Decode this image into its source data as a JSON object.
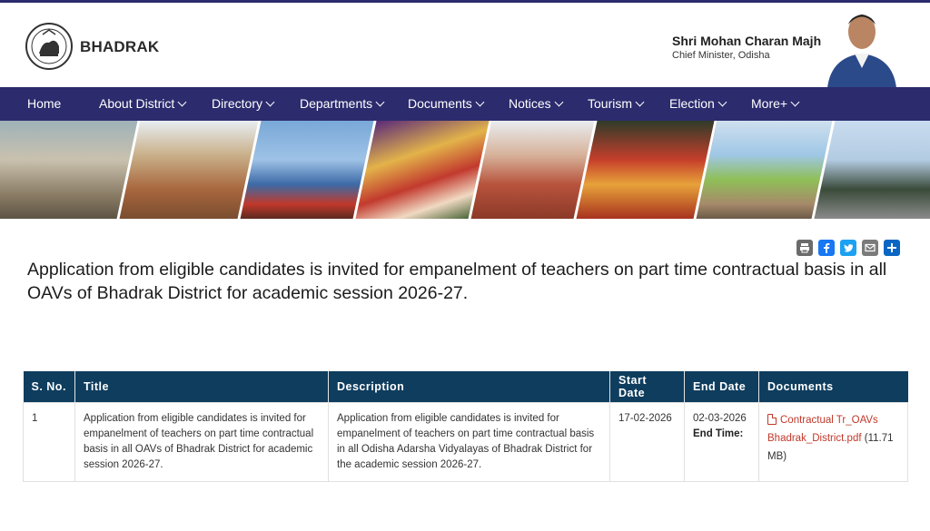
{
  "header": {
    "site_name": "BHADRAK",
    "cm_name": "Shri Mohan Charan Majhi",
    "cm_title": "Chief Minister, Odisha"
  },
  "nav": {
    "items": [
      {
        "label": "Home",
        "dropdown": false
      },
      {
        "label": "About District",
        "dropdown": true
      },
      {
        "label": "Directory",
        "dropdown": true
      },
      {
        "label": "Departments",
        "dropdown": true
      },
      {
        "label": "Documents",
        "dropdown": true
      },
      {
        "label": "Notices",
        "dropdown": true
      },
      {
        "label": "Tourism",
        "dropdown": true
      },
      {
        "label": "Election",
        "dropdown": true
      },
      {
        "label": "More+",
        "dropdown": true
      }
    ]
  },
  "share": {
    "icons": [
      "print-icon",
      "facebook-icon",
      "twitter-icon",
      "email-icon",
      "share-plus-icon"
    ],
    "colors": {
      "print": "#6b6b6b",
      "facebook": "#1877f2",
      "twitter": "#1da1f2",
      "email": "#7b7b7b",
      "share": "#0a66c2"
    }
  },
  "page": {
    "title": "Application from eligible candidates is invited for empanelment of teachers on part time contractual basis in all OAVs of Bhadrak District for academic session 2026-27."
  },
  "table": {
    "headers": [
      "S. No.",
      "Title",
      "Description",
      "Start Date",
      "End Date",
      "Documents"
    ],
    "rows": [
      {
        "sno": "1",
        "title": "Application from eligible candidates is invited for empanelment of teachers on part time contractual basis in all OAVs of Bhadrak District for academic session 2026-27.",
        "description": "Application from eligible candidates is invited for empanelment of teachers on part time contractual basis in all Odisha Adarsha Vidyalayas of Bhadrak District for the academic session 2026-27.",
        "start_date": "17-02-2026",
        "end_date": "02-03-2026",
        "end_time_label": "End Time:",
        "document_name": "Contractual Tr_OAVs Bhadrak_District.pdf",
        "document_size": "(11.71 MB)"
      }
    ]
  },
  "colors": {
    "nav_bg": "#2c2b6e",
    "table_header_bg": "#0e3d5e",
    "link_color": "#c0392b"
  }
}
